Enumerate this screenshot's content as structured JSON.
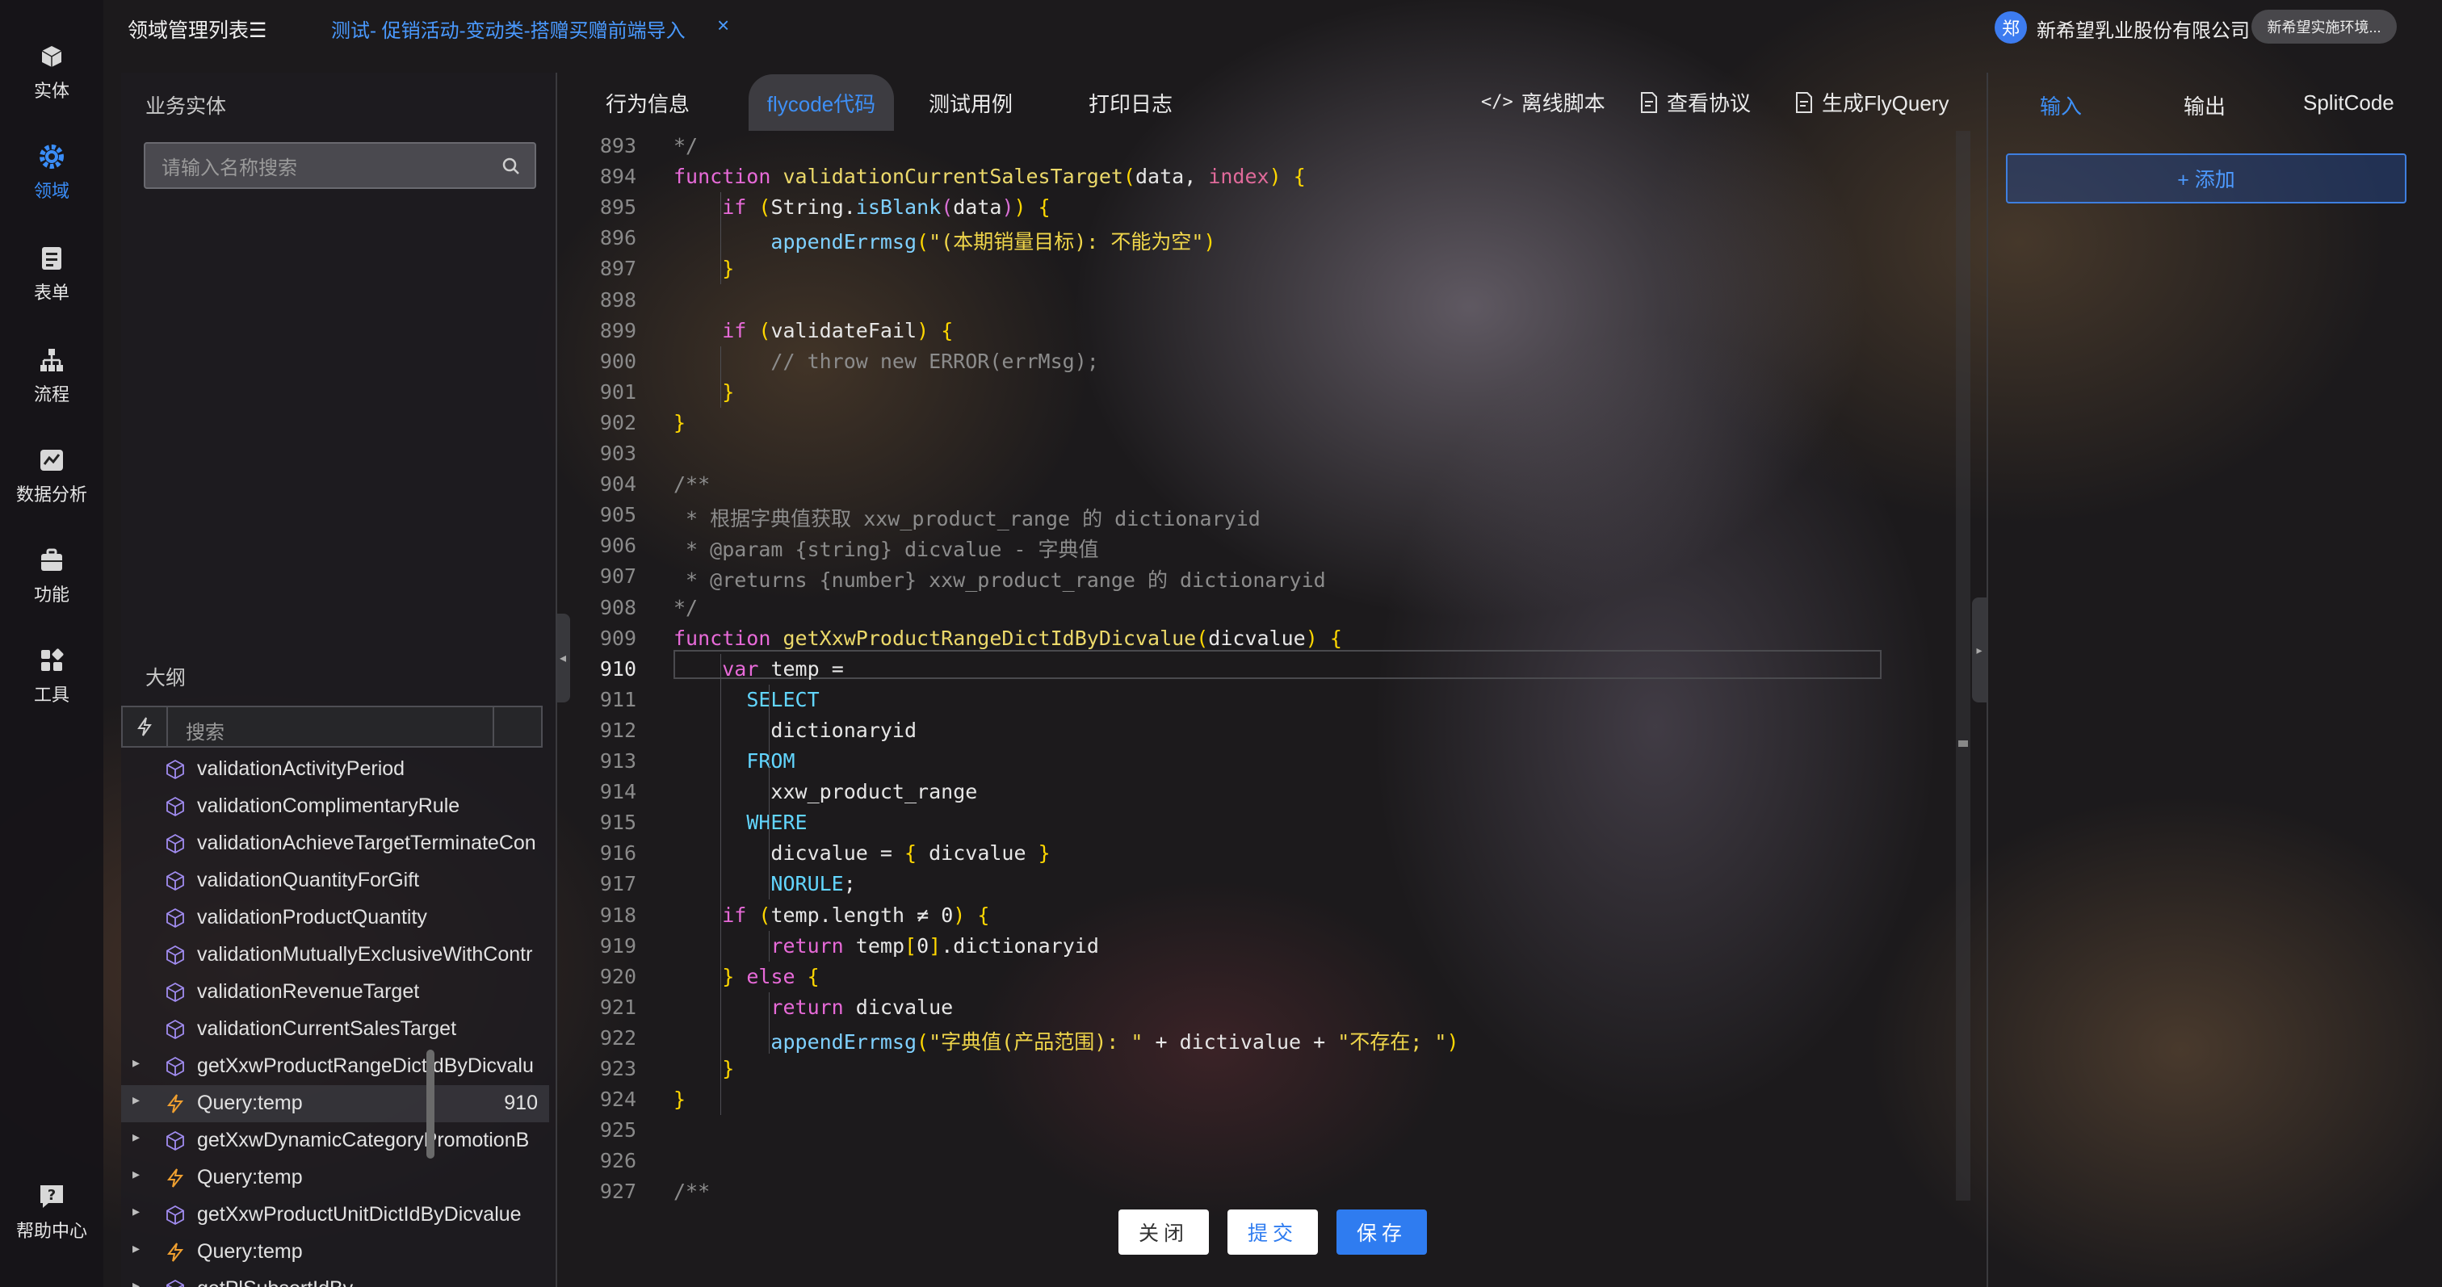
{
  "sidebar": {
    "items": [
      {
        "label": "实体",
        "icon": "cube-icon"
      },
      {
        "label": "领域",
        "icon": "gear-icon",
        "active": true
      },
      {
        "label": "表单",
        "icon": "form-icon"
      },
      {
        "label": "流程",
        "icon": "flow-icon"
      },
      {
        "label": "数据分析",
        "icon": "chart-icon"
      },
      {
        "label": "功能",
        "icon": "briefcase-icon"
      },
      {
        "label": "工具",
        "icon": "grid-icon"
      }
    ],
    "help_label": "帮助中心"
  },
  "header": {
    "title": "领域管理列表☰",
    "tab_label": "测试- 促销活动-变动类-搭赠买赠前端导入",
    "tab_close": "×",
    "avatar_text": "郑",
    "company": "新希望乳业股份有限公司",
    "env_badge": "新希望实施环境..."
  },
  "entity_panel": {
    "heading": "业务实体",
    "search_placeholder": "请输入名称搜索"
  },
  "outline": {
    "heading": "大纲",
    "search_placeholder": "搜索",
    "items": [
      {
        "label": "validationActivityPeriod",
        "type": "cube",
        "caret": false
      },
      {
        "label": "validationComplimentaryRule",
        "type": "cube",
        "caret": false
      },
      {
        "label": "validationAchieveTargetTerminateCon",
        "type": "cube",
        "caret": false
      },
      {
        "label": "validationQuantityForGift",
        "type": "cube",
        "caret": false
      },
      {
        "label": "validationProductQuantity",
        "type": "cube",
        "caret": false
      },
      {
        "label": "validationMutuallyExclusiveWithContr",
        "type": "cube",
        "caret": false
      },
      {
        "label": "validationRevenueTarget",
        "type": "cube",
        "caret": false
      },
      {
        "label": "validationCurrentSalesTarget",
        "type": "cube",
        "caret": false
      },
      {
        "label": "getXxwProductRangeDictIdByDicvalu",
        "type": "cube",
        "caret": true
      },
      {
        "label": "Query:temp",
        "type": "bolt",
        "caret": true,
        "selected": true,
        "line": "910"
      },
      {
        "label": "getXxwDynamicCategoryPromotionB",
        "type": "cube",
        "caret": true
      },
      {
        "label": "Query:temp",
        "type": "bolt",
        "caret": true
      },
      {
        "label": "getXxwProductUnitDictIdByDicvalue",
        "type": "cube",
        "caret": true
      },
      {
        "label": "Query:temp",
        "type": "bolt",
        "caret": true
      },
      {
        "label": "getPlSubsortIdBy...",
        "type": "cube",
        "caret": true
      }
    ]
  },
  "editor_tabs": [
    {
      "label": "行为信息"
    },
    {
      "label": "flycode代码",
      "active": true
    },
    {
      "label": "测试用例"
    },
    {
      "label": "打印日志"
    }
  ],
  "toolbar": {
    "offline_script": "离线脚本",
    "view_protocol": "查看协议",
    "gen_flyquery": "生成FlyQuery"
  },
  "code": {
    "current_line": "910",
    "lines": [
      {
        "n": "893",
        "t": "*/"
      },
      {
        "n": "894",
        "t": "function validationCurrentSalesTarget(data, index) {"
      },
      {
        "n": "895",
        "t": "    if (String.isBlank(data)) {"
      },
      {
        "n": "896",
        "t": "        appendErrmsg(\"(本期销量目标): 不能为空\")"
      },
      {
        "n": "897",
        "t": "    }"
      },
      {
        "n": "898",
        "t": ""
      },
      {
        "n": "899",
        "t": "    if (validateFail) {"
      },
      {
        "n": "900",
        "t": "        // throw new ERROR(errMsg);"
      },
      {
        "n": "901",
        "t": "    }"
      },
      {
        "n": "902",
        "t": "}"
      },
      {
        "n": "903",
        "t": ""
      },
      {
        "n": "904",
        "t": "/**"
      },
      {
        "n": "905",
        "t": " * 根据字典值获取 xxw_product_range 的 dictionaryid"
      },
      {
        "n": "906",
        "t": " * @param {string} dicvalue - 字典值"
      },
      {
        "n": "907",
        "t": " * @returns {number} xxw_product_range 的 dictionaryid"
      },
      {
        "n": "908",
        "t": "*/"
      },
      {
        "n": "909",
        "t": "function getXxwProductRangeDictIdByDicvalue(dicvalue) {"
      },
      {
        "n": "910",
        "t": "    var temp ="
      },
      {
        "n": "911",
        "t": "      SELECT"
      },
      {
        "n": "912",
        "t": "        dictionaryid"
      },
      {
        "n": "913",
        "t": "      FROM"
      },
      {
        "n": "914",
        "t": "        xxw_product_range"
      },
      {
        "n": "915",
        "t": "      WHERE"
      },
      {
        "n": "916",
        "t": "        dicvalue = { dicvalue }"
      },
      {
        "n": "917",
        "t": "        NORULE;"
      },
      {
        "n": "918",
        "t": "    if (temp.length ≠ 0) {"
      },
      {
        "n": "919",
        "t": "        return temp[0].dictionaryid"
      },
      {
        "n": "920",
        "t": "    } else {"
      },
      {
        "n": "921",
        "t": "        return dicvalue"
      },
      {
        "n": "922",
        "t": "        appendErrmsg(\"字典值(产品范围): \" + dictivalue + \"不存在; \")"
      },
      {
        "n": "923",
        "t": "    }"
      },
      {
        "n": "924",
        "t": "}"
      },
      {
        "n": "925",
        "t": ""
      },
      {
        "n": "926",
        "t": ""
      },
      {
        "n": "927",
        "t": "/**"
      }
    ]
  },
  "actions": {
    "close": "关闭",
    "submit": "提交",
    "save": "保存"
  },
  "right_panel": {
    "tabs": [
      {
        "label": "输入",
        "active": true
      },
      {
        "label": "输出"
      },
      {
        "label": "SplitCode"
      }
    ],
    "add_label": "+ 添加"
  },
  "colors": {
    "accent": "#3e8ff5",
    "keyword": "#e76ad8",
    "function": "#ecd96a",
    "string": "#f0d64a",
    "comment": "#8c8c8c",
    "sql": "#62d6ff"
  }
}
